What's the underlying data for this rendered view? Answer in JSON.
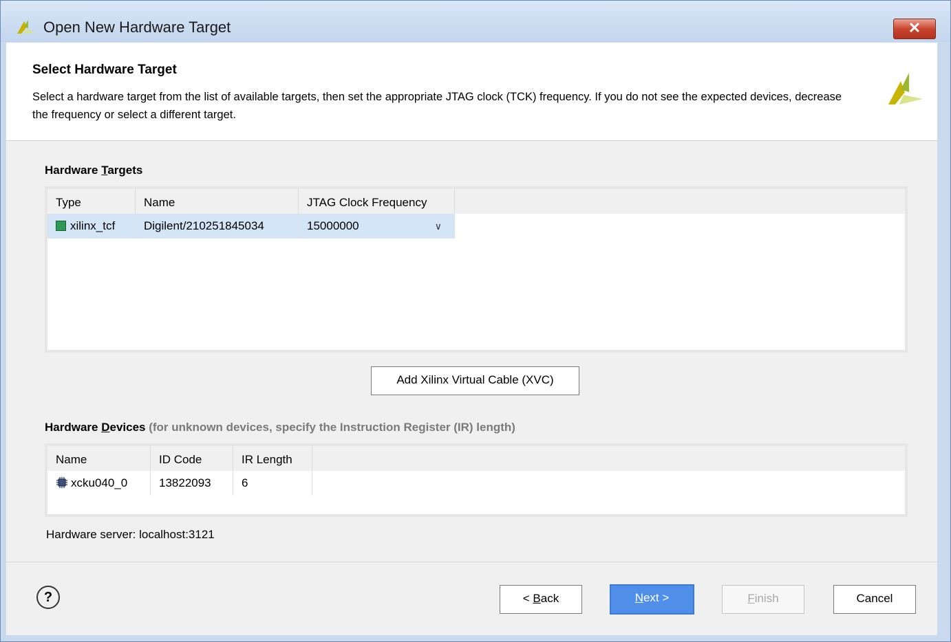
{
  "window": {
    "title": "Open New Hardware Target",
    "close_label": "✕",
    "logo_icon": "xilinx-logo-icon"
  },
  "header": {
    "title": "Select Hardware Target",
    "description": "Select a hardware target from the list of available targets, then set the appropriate JTAG clock (TCK) frequency. If you do not see the expected devices, decrease the frequency or select a different target."
  },
  "targets": {
    "label_pre": "Hardware ",
    "label_u": "T",
    "label_post": "argets",
    "columns": [
      "Type",
      "Name",
      "JTAG Clock Frequency"
    ],
    "rows": [
      {
        "type": "xilinx_tcf",
        "name": "Digilent/210251845034",
        "frequency": "15000000",
        "selected": true
      }
    ]
  },
  "xvc_button": "Add Xilinx Virtual Cable (XVC)",
  "devices": {
    "label_pre": "Hardware ",
    "label_u": "D",
    "label_post": "evices",
    "hint": " (for unknown devices, specify the Instruction Register (IR) length)",
    "columns": [
      "Name",
      "ID Code",
      "IR Length"
    ],
    "rows": [
      {
        "name": "xcku040_0",
        "id_code": "13822093",
        "ir_length": "6"
      }
    ]
  },
  "server": "Hardware server: localhost:3121",
  "footer": {
    "help": "?",
    "back_pre": "< ",
    "back_u": "B",
    "back_post": "ack",
    "next_u": "N",
    "next_post": "ext >",
    "finish_u": "F",
    "finish_post": "inish",
    "cancel": "Cancel"
  },
  "colors": {
    "accent": "#4f8fe9",
    "selection": "#d5e5f8",
    "logo": "#a8c43a"
  }
}
